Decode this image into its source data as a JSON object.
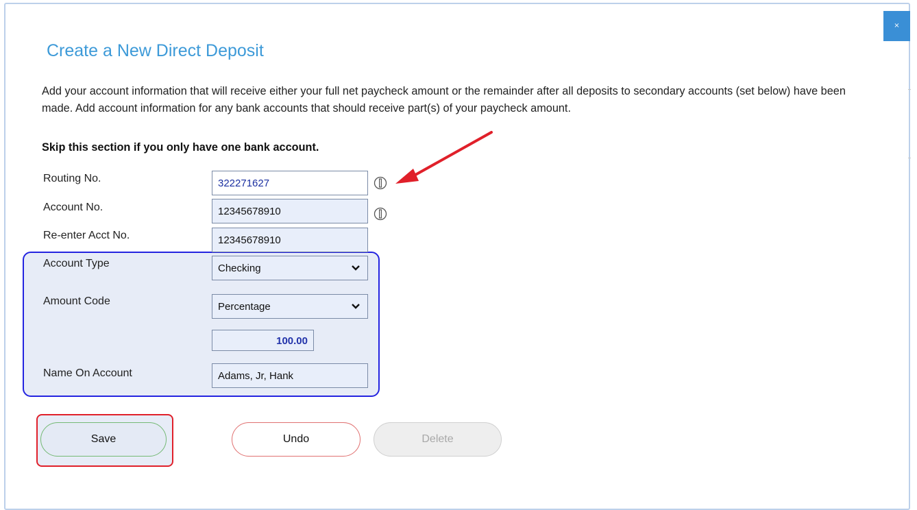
{
  "dialog": {
    "title": "Create a New Direct Deposit",
    "close_label": "×",
    "description": "Add your account information that will receive either your full net paycheck amount or the remainder after all deposits to secondary accounts (set below) have been made. Add account information for any bank accounts that should receive part(s) of your paycheck amount.",
    "skip_note": "Skip this section if you only have one bank account."
  },
  "form": {
    "routing": {
      "label": "Routing No.",
      "value": "322271627",
      "info_icon": "info-circle-icon"
    },
    "account": {
      "label": "Account No.",
      "value": "12345678910",
      "info_icon": "info-circle-icon"
    },
    "reenter": {
      "label": "Re-enter Acct No.",
      "value": "12345678910"
    },
    "account_type": {
      "label": "Account Type",
      "selected": "Checking"
    },
    "amount_code": {
      "label": "Amount Code",
      "selected": "Percentage"
    },
    "amount": {
      "value": "100.00"
    },
    "name_on_account": {
      "label": "Name On Account",
      "value": "Adams, Jr, Hank"
    }
  },
  "buttons": {
    "save": "Save",
    "undo": "Undo",
    "delete": "Delete"
  },
  "annotations": {
    "arrow_color": "#e0202a",
    "highlight_blue": "#2323e0",
    "highlight_red": "#e0202a"
  },
  "colors": {
    "title": "#3d9ad8",
    "close_button": "#3a8fd6",
    "save_border": "#74b974",
    "undo_border": "#e07070"
  }
}
